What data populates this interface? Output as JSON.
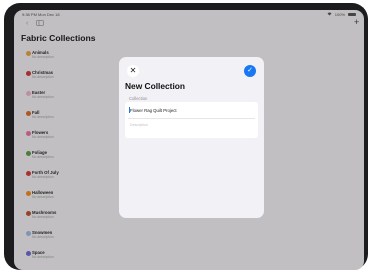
{
  "status_bar": {
    "time": "9:38 PM",
    "date": "Mon Dec 18",
    "wifi": "wifi-icon",
    "battery_pct": "100%"
  },
  "nav": {
    "back_icon": "chevron-left-icon",
    "sidebar_icon": "sidebar-icon",
    "add_icon": "plus-icon",
    "add_symbol": "+"
  },
  "page_title": "Fabric Collections",
  "collections": [
    {
      "name": "Animals",
      "description": "No description",
      "color": "#e0a040"
    },
    {
      "name": "Christmas",
      "description": "No description",
      "color": "#c83a3a"
    },
    {
      "name": "Easter",
      "description": "No description",
      "color": "#e7b0c5"
    },
    {
      "name": "Fall",
      "description": "No description",
      "color": "#d46a2a"
    },
    {
      "name": "Flowers",
      "description": "No description",
      "color": "#e26fa0"
    },
    {
      "name": "Foliage",
      "description": "No description",
      "color": "#5a9a44"
    },
    {
      "name": "Forth Of July",
      "description": "No description",
      "color": "#d23a3a"
    },
    {
      "name": "Halloween",
      "description": "No description",
      "color": "#f08a1c"
    },
    {
      "name": "Mushrooms",
      "description": "No description",
      "color": "#b5542f"
    },
    {
      "name": "Snowmen",
      "description": "No description",
      "color": "#9ab7d8"
    },
    {
      "name": "Space",
      "description": "No description",
      "color": "#6a6ad0"
    }
  ],
  "modal": {
    "close_symbol": "✕",
    "save_symbol": "✓",
    "title": "New Collection",
    "section_label": "Collection",
    "name_value": "Flower Rag Quilt Project",
    "description_placeholder": "Description",
    "accent": "#1877f2"
  }
}
